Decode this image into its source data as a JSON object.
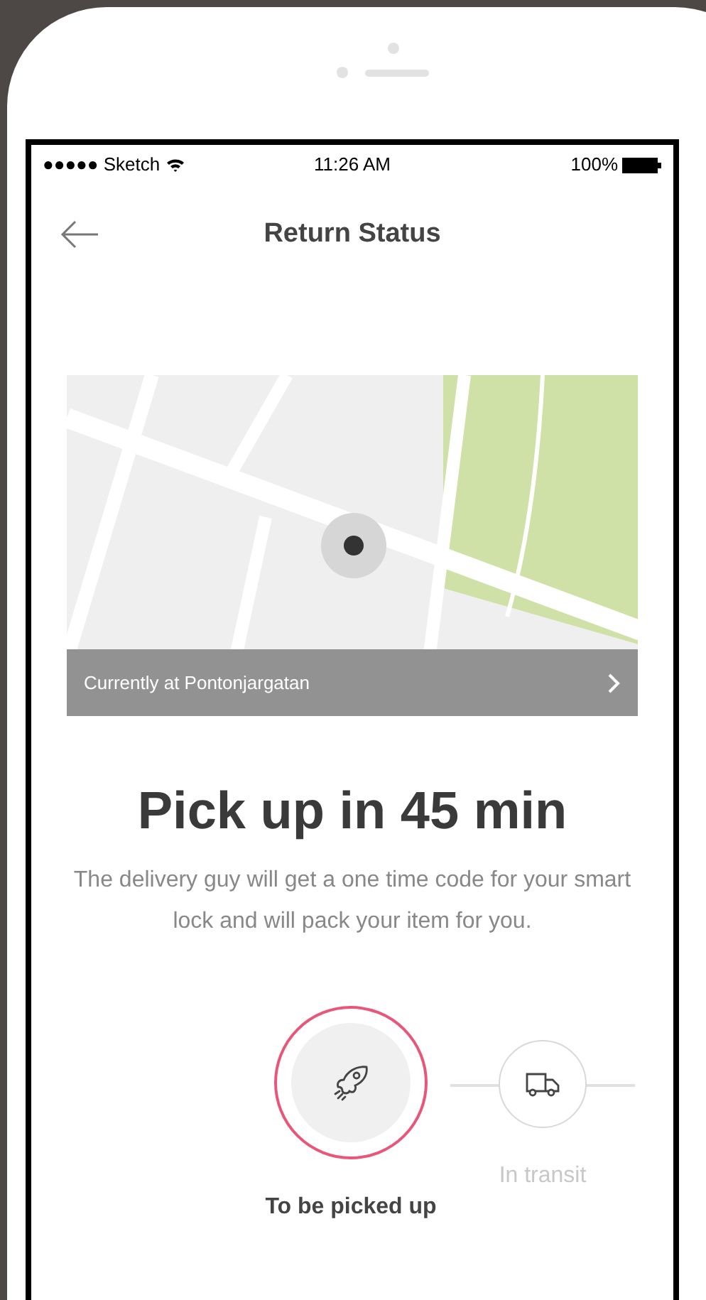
{
  "status_bar": {
    "carrier": "●●●●● Sketch",
    "time": "11:26 AM",
    "battery": "100%"
  },
  "header": {
    "title": "Return Status"
  },
  "map": {
    "kind": "picture",
    "caption": "Currently at Pontonjargatan"
  },
  "heading": "Pick up in 45 min",
  "description": "The delivery guy will get a one time code for your smart lock and will pack your item for you.",
  "steps": [
    {
      "kind": "rocket",
      "label": "To be picked up",
      "selected": true
    },
    {
      "kind": "truck",
      "label": "In transit",
      "selected": false
    }
  ]
}
